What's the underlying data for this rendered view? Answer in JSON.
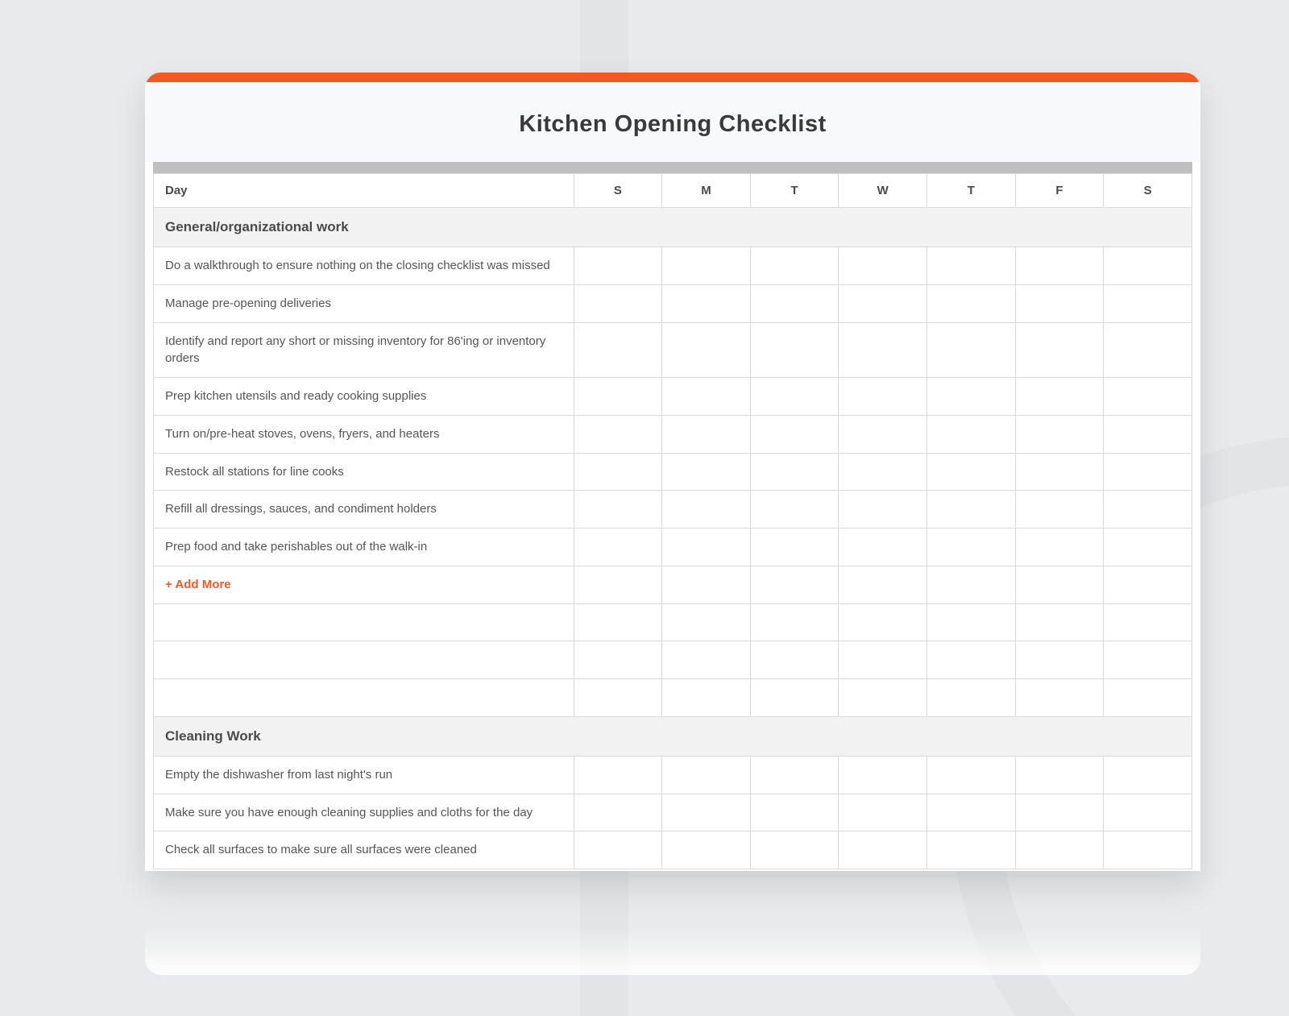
{
  "title": "Kitchen Opening Checklist",
  "header": {
    "task_label": "Day",
    "days": [
      "S",
      "M",
      "T",
      "W",
      "T",
      "F",
      "S"
    ]
  },
  "sections": [
    {
      "heading": "General/organizational work",
      "items": [
        "Do a walkthrough to ensure nothing on the closing checklist was missed",
        "Manage pre-opening deliveries",
        "Identify and report any short or missing inventory for 86'ing or inventory orders",
        "Prep kitchen utensils and ready cooking supplies",
        "Turn on/pre-heat stoves, ovens, fryers, and heaters",
        "Restock all stations for line cooks",
        "Refill all dressings, sauces, and condiment holders",
        "Prep food and take perishables out of the walk-in"
      ],
      "add_more_label": "+ Add More",
      "blank_rows": 3
    },
    {
      "heading": "Cleaning Work",
      "items": [
        "Empty the dishwasher from last night's run",
        "Make sure you have enough cleaning supplies and cloths for the day",
        "Check all surfaces to make sure all surfaces were cleaned"
      ]
    }
  ]
}
